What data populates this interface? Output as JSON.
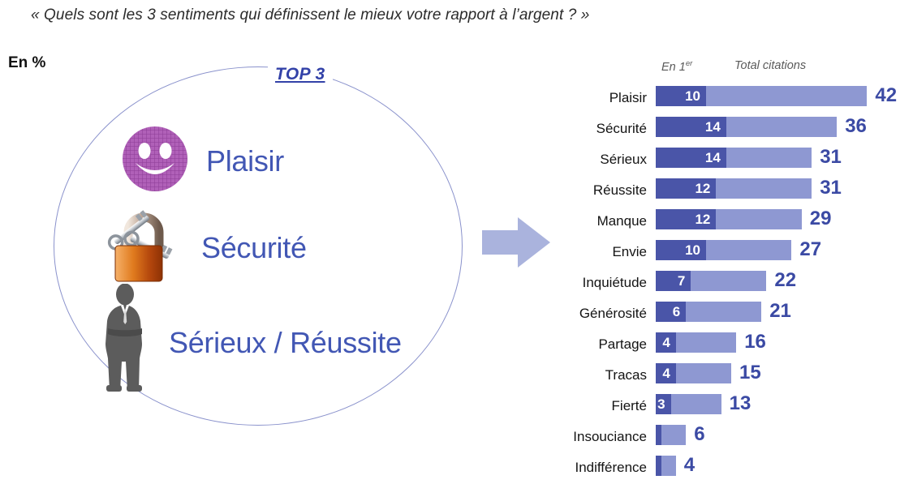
{
  "question": "« Quels sont les 3 sentiments qui définissent le mieux votre rapport à l’argent ? »",
  "unit_note": "En %",
  "circle": {
    "badge": "TOP 3",
    "items": [
      {
        "icon": "smiley-face-icon",
        "label": "Plaisir"
      },
      {
        "icon": "padlock-icon",
        "label": "Sécurité"
      },
      {
        "icon": "businessman-silhouette-icon",
        "label": "Sérieux / Réussite"
      }
    ]
  },
  "arrow": {
    "icon": "right-arrow-icon",
    "color": "#aab3dd"
  },
  "colors": {
    "first_choice": "#4a55a8",
    "total": "#8e98d2",
    "total_label": "#3b4aa4",
    "circle_outline": "#8a92cc",
    "circle_label": "#4257b4",
    "badge": "#3342a8"
  },
  "chart_data": {
    "type": "bar",
    "orientation": "horizontal",
    "stacked": true,
    "title": "« Quels sont les 3 sentiments qui définissent le mieux votre rapport à l’argent ? »",
    "xlabel": "",
    "ylabel": "",
    "unit": "%",
    "grid": false,
    "legend_position": "top",
    "xlim": [
      0,
      42
    ],
    "column_headers": [
      "En 1er",
      "Total citations"
    ],
    "categories": [
      "Plaisir",
      "Sécurité",
      "Sérieux",
      "Réussite",
      "Manque",
      "Envie",
      "Inquiétude",
      "Générosité",
      "Partage",
      "Tracas",
      "Fierté",
      "Insouciance",
      "Indifférence"
    ],
    "series": [
      {
        "name": "En 1er",
        "color": "#4a55a8",
        "values": [
          10,
          14,
          14,
          12,
          12,
          10,
          7,
          6,
          4,
          4,
          3,
          1,
          1
        ]
      },
      {
        "name": "Total citations",
        "color": "#8e98d2",
        "values": [
          42,
          36,
          31,
          31,
          29,
          27,
          22,
          21,
          16,
          15,
          13,
          6,
          4
        ]
      }
    ],
    "rows": [
      {
        "category": "Plaisir",
        "first": 10,
        "first_label": "10",
        "total": 42,
        "total_label": "42"
      },
      {
        "category": "Sécurité",
        "first": 14,
        "first_label": "14",
        "total": 36,
        "total_label": "36"
      },
      {
        "category": "Sérieux",
        "first": 14,
        "first_label": "14",
        "total": 31,
        "total_label": "31"
      },
      {
        "category": "Réussite",
        "first": 12,
        "first_label": "12",
        "total": 31,
        "total_label": "31"
      },
      {
        "category": "Manque",
        "first": 12,
        "first_label": "12",
        "total": 29,
        "total_label": "29"
      },
      {
        "category": "Envie",
        "first": 10,
        "first_label": "10",
        "total": 27,
        "total_label": "27"
      },
      {
        "category": "Inquiétude",
        "first": 7,
        "first_label": "7",
        "total": 22,
        "total_label": "22"
      },
      {
        "category": "Générosité",
        "first": 6,
        "first_label": "6",
        "total": 21,
        "total_label": "21"
      },
      {
        "category": "Partage",
        "first": 4,
        "first_label": "4",
        "total": 16,
        "total_label": "16"
      },
      {
        "category": "Tracas",
        "first": 4,
        "first_label": "4",
        "total": 15,
        "total_label": "15"
      },
      {
        "category": "Fierté",
        "first": 3,
        "first_label": "3",
        "total": 13,
        "total_label": "13"
      },
      {
        "category": "Insouciance",
        "first": 1,
        "first_label": "",
        "total": 6,
        "total_label": "6"
      },
      {
        "category": "Indifférence",
        "first": 1,
        "first_label": "",
        "total": 4,
        "total_label": "4"
      }
    ]
  }
}
